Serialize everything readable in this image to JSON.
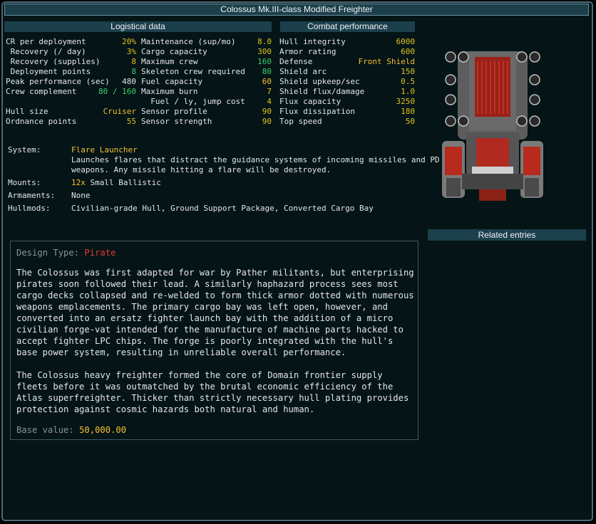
{
  "title": "Colossus Mk.III-class Modified Freighter",
  "logistical": {
    "header": "Logistical data",
    "left": [
      {
        "label": "CR per deployment",
        "value": "20%",
        "color": "y"
      },
      {
        "label": " Recovery (/ day)",
        "value": "3%",
        "color": "y"
      },
      {
        "label": " Recovery (supplies)",
        "value": "8",
        "color": "y"
      },
      {
        "label": " Deployment points",
        "value": "8",
        "color": "g"
      },
      {
        "label": "Peak performance (sec)",
        "value": "480",
        "color": "w"
      },
      {
        "label": "Crew complement",
        "value": "80 / 160",
        "color": "g"
      },
      {
        "label": "",
        "value": "",
        "color": "w"
      },
      {
        "label": "Hull size",
        "value": "Cruiser",
        "color": "o"
      },
      {
        "label": "Ordnance points",
        "value": "55",
        "color": "y"
      }
    ],
    "right": [
      {
        "label": "Maintenance (sup/mo)",
        "value": "8.0",
        "color": "y"
      },
      {
        "label": "Cargo capacity",
        "value": "300",
        "color": "y"
      },
      {
        "label": "Maximum crew",
        "value": "160",
        "color": "g"
      },
      {
        "label": "Skeleton crew required",
        "value": "80",
        "color": "g"
      },
      {
        "label": "Fuel capacity",
        "value": "60",
        "color": "o"
      },
      {
        "label": "Maximum burn",
        "value": "7",
        "color": "y"
      },
      {
        "label": "  Fuel / ly, jump cost",
        "value": "4",
        "color": "y"
      },
      {
        "label": "Sensor profile",
        "value": "90",
        "color": "y"
      },
      {
        "label": "Sensor strength",
        "value": "90",
        "color": "y"
      }
    ]
  },
  "combat": {
    "header": "Combat performance",
    "rows": [
      {
        "label": "Hull integrity",
        "value": "6000",
        "color": "y"
      },
      {
        "label": "Armor rating",
        "value": "600",
        "color": "y"
      },
      {
        "label": "Defense",
        "value": "Front Shield",
        "color": "o"
      },
      {
        "label": "Shield arc",
        "value": "150",
        "color": "y"
      },
      {
        "label": "Shield upkeep/sec",
        "value": "0.5",
        "color": "y"
      },
      {
        "label": "Shield flux/damage",
        "value": "1.0",
        "color": "y"
      },
      {
        "label": "Flux capacity",
        "value": "3250",
        "color": "y"
      },
      {
        "label": "Flux dissipation",
        "value": "180",
        "color": "y"
      },
      {
        "label": "Top speed",
        "value": "50",
        "color": "y"
      }
    ]
  },
  "system": {
    "label": "System:",
    "name": "Flare Launcher",
    "desc1": "Launches flares that distract the guidance systems of incoming missiles and PD",
    "desc2": "weapons. Any missile hitting a flare will be destroyed."
  },
  "mounts": {
    "label": "Mounts:",
    "count": "12x",
    "type": "Small Ballistic"
  },
  "armaments": {
    "label": "Armaments:",
    "value": "None"
  },
  "hullmods": {
    "label": "Hullmods:",
    "value": "Civilian-grade Hull, Ground Support Package, Converted Cargo Bay"
  },
  "related": {
    "header": "Related entries"
  },
  "description": {
    "design_label": "Design Type:",
    "design_value": "Pirate",
    "paragraph1": "The Colossus was first adapted for war by Pather militants, but enterprising pirates soon followed their lead. A similarly haphazard process sees most cargo decks collapsed and re-welded to form thick armor dotted with numerous weapons emplacements. The primary cargo bay was left open, however, and converted into an ersatz fighter launch bay with the addition of a micro civilian forge-vat intended for the manufacture of machine parts hacked to accept fighter LPC chips. The forge is poorly integrated with the hull's base power system, resulting in unreliable overall performance.",
    "paragraph2": "The Colossus heavy freighter formed the core of Domain frontier supply fleets before it was outmatched by the brutal economic efficiency of the Atlas superfreighter. Thicker than strictly necessary hull plating provides protection against cosmic hazards both natural and human.",
    "base_label": "Base value:",
    "base_value": "50,000.00"
  },
  "colors": {
    "panel": "#041417",
    "header": "#1c3f4c",
    "yellow": "#e2c21c",
    "green": "#39d16b",
    "orange": "#f4c030",
    "red": "#e03a2a"
  }
}
